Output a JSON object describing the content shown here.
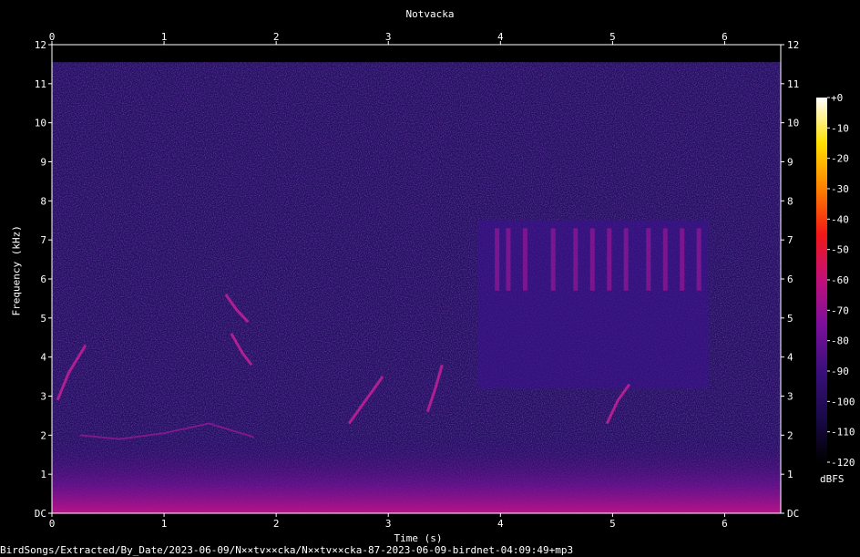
{
  "title": "Notvacka",
  "xlabel": "Time (s)",
  "ylabel": "Frequency (kHz)",
  "colorbar_label": "dBFS",
  "filename": "BirdSongs/Extracted/By_Date/2023-06-09/N××tv××cka/N××tv××cka-87-2023-06-09-birdnet-04:09:49+mp3",
  "chart_data": {
    "type": "heatmap",
    "title": "Notvacka",
    "xlabel": "Time (s)",
    "ylabel": "Frequency (kHz)",
    "xlim": [
      0,
      6.5
    ],
    "ylim": [
      0,
      12
    ],
    "x_ticks": [
      "0",
      "1",
      "2",
      "3",
      "4",
      "5",
      "6"
    ],
    "y_ticks": [
      "DC",
      "1",
      "2",
      "3",
      "4",
      "5",
      "6",
      "7",
      "8",
      "9",
      "10",
      "11",
      "12"
    ],
    "colorbar": {
      "label": "dBFS",
      "range": [
        -120,
        0
      ],
      "ticks": [
        "+0",
        "-10",
        "-20",
        "-30",
        "-40",
        "-50",
        "-60",
        "-70",
        "-80",
        "-90",
        "-100",
        "-110",
        "-120"
      ]
    },
    "colormap": [
      "#000000",
      "#1a0a4a",
      "#3a0f7a",
      "#7a0f9a",
      "#c0107a",
      "#f01818",
      "#ff8000",
      "#ffe000",
      "#ffffff"
    ],
    "grid": false
  }
}
